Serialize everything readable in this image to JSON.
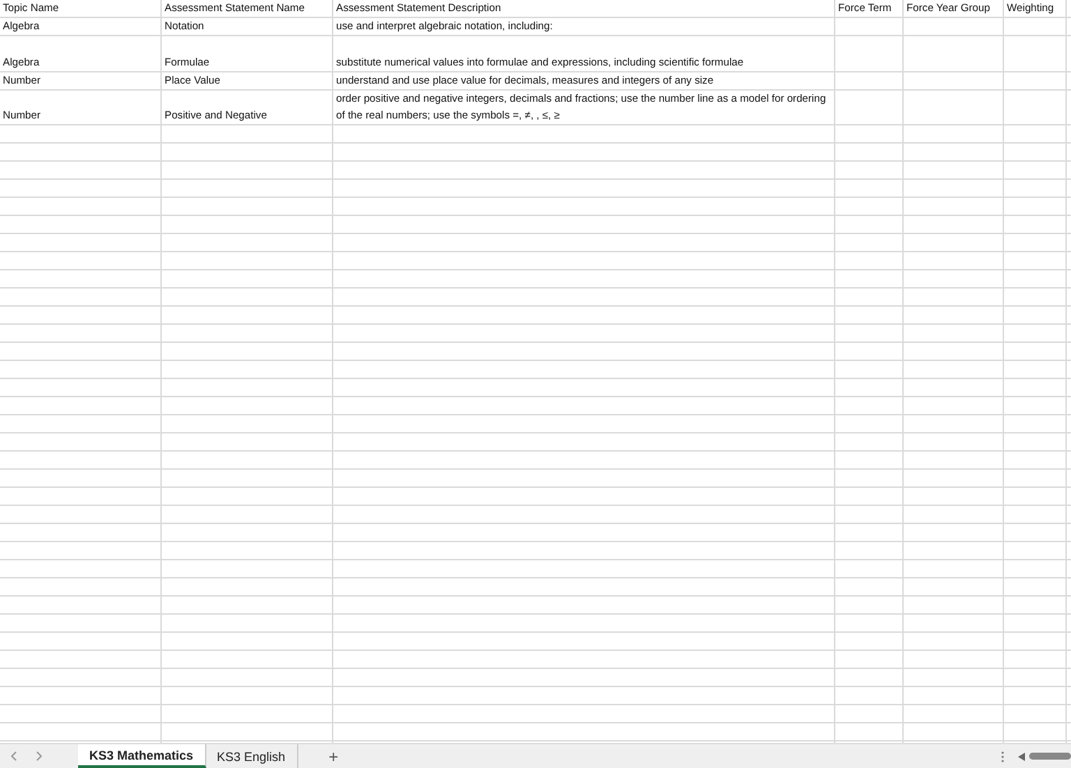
{
  "table": {
    "columns": [
      "Topic Name",
      "Assessment Statement Name",
      "Assessment Statement Description",
      "Force Term",
      "Force Year Group",
      "Weighting"
    ],
    "rows": [
      [
        "Algebra",
        "Notation",
        "use and interpret algebraic notation, including:",
        "",
        "",
        ""
      ],
      [
        "Algebra",
        "Formulae",
        "substitute numerical values into formulae and expressions, including scientific formulae",
        "",
        "",
        ""
      ],
      [
        "Number",
        "Place Value",
        "understand and use place value for decimals, measures and integers of any size",
        "",
        "",
        ""
      ],
      [
        "Number",
        "Positive and Negative",
        "order positive and negative integers, decimals and fractions; use the number line as a model for ordering of the real numbers; use the symbols =, ≠, , ≤, ≥",
        "",
        "",
        ""
      ]
    ]
  },
  "sheet_tabs": [
    {
      "label": "KS3 Mathematics",
      "selected": true
    },
    {
      "label": "KS3 English",
      "selected": false
    }
  ],
  "add_sheet": "+"
}
